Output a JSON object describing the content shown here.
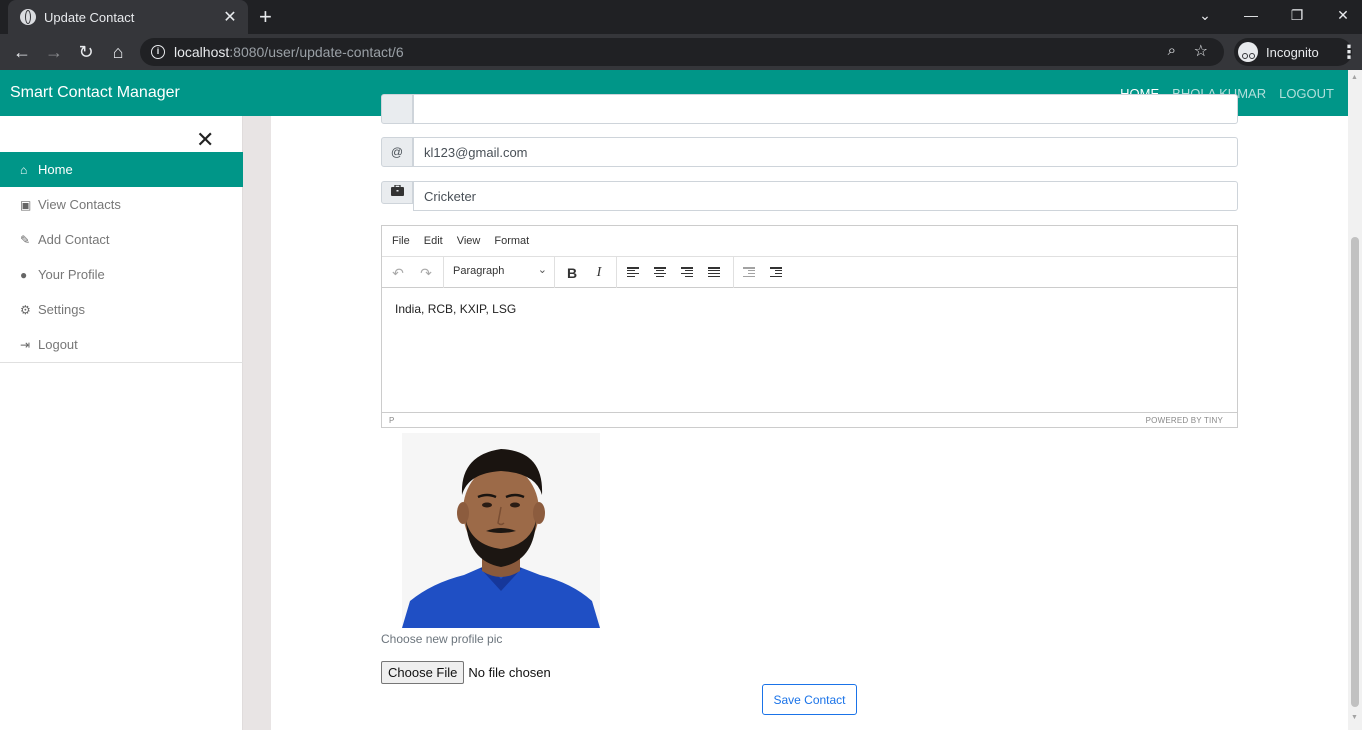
{
  "browser": {
    "tab_title": "Update Contact",
    "url_host": "localhost",
    "url_rest": ":8080/user/update-contact/6",
    "profile_label": "Incognito"
  },
  "app": {
    "brand": "Smart Contact Manager",
    "nav": [
      "HOME",
      "BHOLA KUMAR",
      "LOGOUT"
    ]
  },
  "sidebar": {
    "items": [
      {
        "label": "Home",
        "icon": "home-icon",
        "active": true
      },
      {
        "label": "View Contacts",
        "icon": "address-book-icon",
        "active": false
      },
      {
        "label": "Add Contact",
        "icon": "pencil-icon",
        "active": false
      },
      {
        "label": "Your Profile",
        "icon": "user-circle-icon",
        "active": false
      },
      {
        "label": "Settings",
        "icon": "cogs-icon",
        "active": false
      },
      {
        "label": "Logout",
        "icon": "sign-out-icon",
        "active": false
      }
    ]
  },
  "form": {
    "email": {
      "addon": "@",
      "value": "kl123@gmail.com"
    },
    "work": {
      "addon_icon": "briefcase-icon",
      "value": "Cricketer"
    },
    "editor": {
      "menu": [
        "File",
        "Edit",
        "View",
        "Format"
      ],
      "block_format": "Paragraph",
      "content": "India, RCB, KXIP, LSG",
      "status_path": "P",
      "branding": "POWERED BY TINY"
    },
    "new_pic_label": "Choose new profile pic",
    "choose_file_label": "Choose File",
    "no_file_text": "No file chosen",
    "save_label": "Save Contact"
  },
  "colors": {
    "primary": "#009688",
    "save_button": "#1a73e8"
  }
}
